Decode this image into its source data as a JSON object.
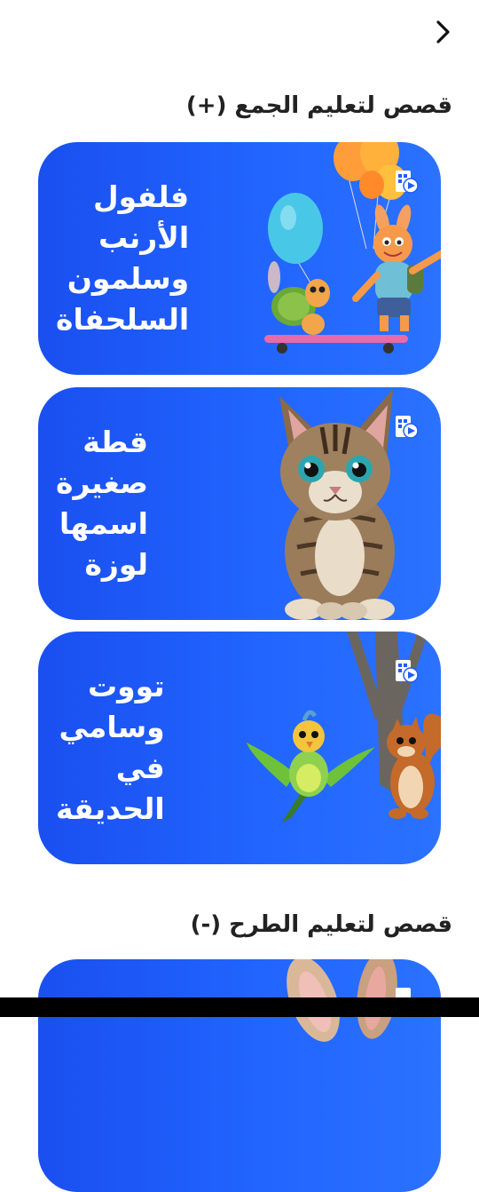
{
  "header": {
    "back_icon": "chevron-right-icon"
  },
  "sections": [
    {
      "title": "قصص لتعليم الجمع (+)"
    },
    {
      "title": "قصص لتعليم الطرح (-)"
    }
  ],
  "cards": [
    {
      "title": "فلفول\nالأرنب\nوسلمون\nالسلحفاة",
      "image": "rabbit-turtle-balloons",
      "icon": "video-story-icon"
    },
    {
      "title": "قطة\nصغيرة\nاسمها\nلوزة",
      "image": "kitten",
      "icon": "video-story-icon"
    },
    {
      "title": "تووت\nوسامي\nفي\nالحديقة",
      "image": "bird-squirrel-tree",
      "icon": "video-story-icon"
    },
    {
      "title": "",
      "image": "rabbit-ears",
      "icon": "video-story-icon"
    }
  ],
  "colors": {
    "card_bg": "#1f5bff",
    "text": "#222222",
    "card_text": "#ffffff"
  }
}
